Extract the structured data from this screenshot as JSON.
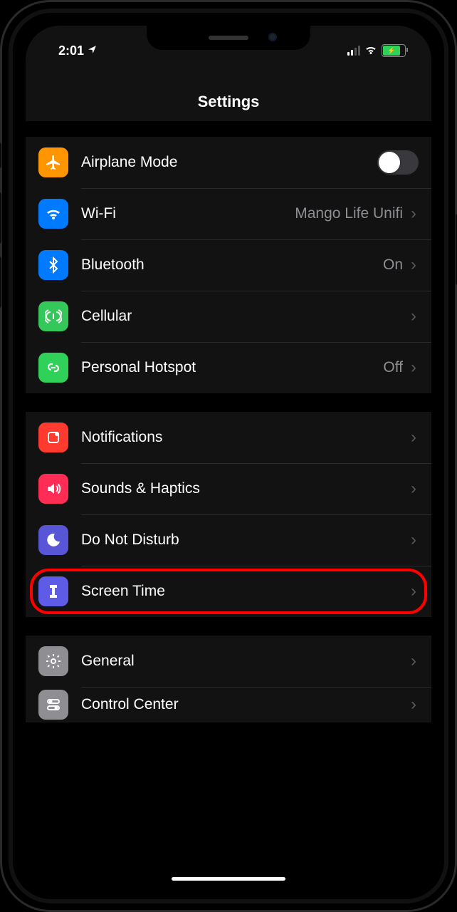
{
  "status": {
    "time": "2:01",
    "location_icon": "location-arrow",
    "cell_bars_active": 2,
    "cell_bars_total": 4,
    "wifi_strength": 3,
    "battery_charging": true,
    "battery_color": "#30d158"
  },
  "header": {
    "title": "Settings"
  },
  "groups": [
    {
      "rows": [
        {
          "id": "airplane",
          "icon": "airplane-icon",
          "icon_bg": "ic-orange",
          "label": "Airplane Mode",
          "kind": "toggle",
          "toggle_on": false
        },
        {
          "id": "wifi",
          "icon": "wifi-icon",
          "icon_bg": "ic-blue",
          "label": "Wi-Fi",
          "kind": "nav",
          "value": "Mango Life Unifi"
        },
        {
          "id": "bluetooth",
          "icon": "bluetooth-icon",
          "icon_bg": "ic-blue",
          "label": "Bluetooth",
          "kind": "nav",
          "value": "On"
        },
        {
          "id": "cellular",
          "icon": "cellular-icon",
          "icon_bg": "ic-green",
          "label": "Cellular",
          "kind": "nav",
          "value": ""
        },
        {
          "id": "hotspot",
          "icon": "hotspot-icon",
          "icon_bg": "ic-green2",
          "label": "Personal Hotspot",
          "kind": "nav",
          "value": "Off"
        }
      ]
    },
    {
      "rows": [
        {
          "id": "notifications",
          "icon": "notifications-icon",
          "icon_bg": "ic-red",
          "label": "Notifications",
          "kind": "nav",
          "value": ""
        },
        {
          "id": "sounds",
          "icon": "sounds-icon",
          "icon_bg": "ic-pink",
          "label": "Sounds & Haptics",
          "kind": "nav",
          "value": ""
        },
        {
          "id": "dnd",
          "icon": "dnd-icon",
          "icon_bg": "ic-indigo",
          "label": "Do Not Disturb",
          "kind": "nav",
          "value": ""
        },
        {
          "id": "screentime",
          "icon": "screentime-icon",
          "icon_bg": "ic-purple",
          "label": "Screen Time",
          "kind": "nav",
          "value": "",
          "highlighted": true
        }
      ]
    },
    {
      "rows": [
        {
          "id": "general",
          "icon": "general-icon",
          "icon_bg": "ic-gray",
          "label": "General",
          "kind": "nav",
          "value": ""
        },
        {
          "id": "controlcenter",
          "icon": "controlcenter-icon",
          "icon_bg": "ic-gray",
          "label": "Control Center",
          "kind": "nav",
          "value": ""
        }
      ]
    }
  ]
}
